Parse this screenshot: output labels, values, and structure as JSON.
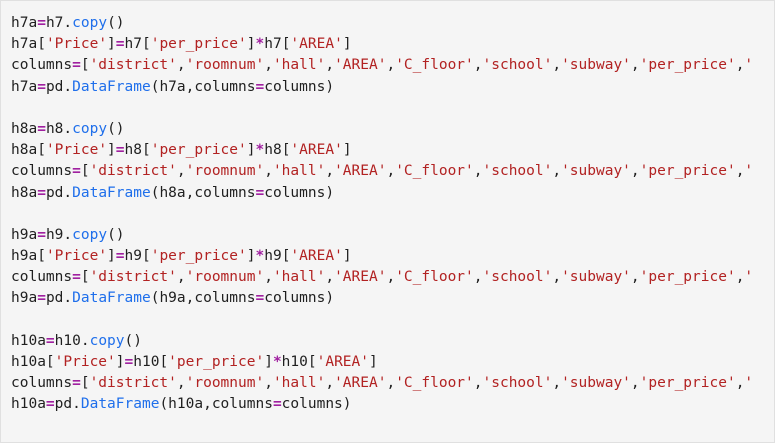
{
  "colors": {
    "panel_background": "#f5f5f5",
    "identifier": "#1f1f1f",
    "operator": "#a020a0",
    "string": "#b22222",
    "attribute": "#1f6feb"
  },
  "code": {
    "blocks": [
      {
        "lines": [
          {
            "tokens": [
              {
                "t": "ident",
                "v": "h7a"
              },
              {
                "t": "op",
                "v": "="
              },
              {
                "t": "ident",
                "v": "h7"
              },
              {
                "t": "punc",
                "v": "."
              },
              {
                "t": "attr",
                "v": "copy"
              },
              {
                "t": "punc",
                "v": "()"
              }
            ]
          },
          {
            "tokens": [
              {
                "t": "ident",
                "v": "h7a"
              },
              {
                "t": "punc",
                "v": "["
              },
              {
                "t": "str",
                "v": "'Price'"
              },
              {
                "t": "punc",
                "v": "]"
              },
              {
                "t": "op",
                "v": "="
              },
              {
                "t": "ident",
                "v": "h7"
              },
              {
                "t": "punc",
                "v": "["
              },
              {
                "t": "str",
                "v": "'per_price'"
              },
              {
                "t": "punc",
                "v": "]"
              },
              {
                "t": "op",
                "v": "*"
              },
              {
                "t": "ident",
                "v": "h7"
              },
              {
                "t": "punc",
                "v": "["
              },
              {
                "t": "str",
                "v": "'AREA'"
              },
              {
                "t": "punc",
                "v": "]"
              }
            ]
          },
          {
            "tokens": [
              {
                "t": "ident",
                "v": "columns"
              },
              {
                "t": "op",
                "v": "="
              },
              {
                "t": "punc",
                "v": "["
              },
              {
                "t": "str",
                "v": "'district'"
              },
              {
                "t": "punc",
                "v": ","
              },
              {
                "t": "str",
                "v": "'roomnum'"
              },
              {
                "t": "punc",
                "v": ","
              },
              {
                "t": "str",
                "v": "'hall'"
              },
              {
                "t": "punc",
                "v": ","
              },
              {
                "t": "str",
                "v": "'AREA'"
              },
              {
                "t": "punc",
                "v": ","
              },
              {
                "t": "str",
                "v": "'C_floor'"
              },
              {
                "t": "punc",
                "v": ","
              },
              {
                "t": "str",
                "v": "'school'"
              },
              {
                "t": "punc",
                "v": ","
              },
              {
                "t": "str",
                "v": "'subway'"
              },
              {
                "t": "punc",
                "v": ","
              },
              {
                "t": "str",
                "v": "'per_price'"
              },
              {
                "t": "punc",
                "v": ","
              },
              {
                "t": "str",
                "v": "'"
              }
            ]
          },
          {
            "tokens": [
              {
                "t": "ident",
                "v": "h7a"
              },
              {
                "t": "op",
                "v": "="
              },
              {
                "t": "ident",
                "v": "pd"
              },
              {
                "t": "punc",
                "v": "."
              },
              {
                "t": "attr",
                "v": "DataFrame"
              },
              {
                "t": "punc",
                "v": "("
              },
              {
                "t": "ident",
                "v": "h7a"
              },
              {
                "t": "punc",
                "v": ","
              },
              {
                "t": "ident",
                "v": "columns"
              },
              {
                "t": "op",
                "v": "="
              },
              {
                "t": "ident",
                "v": "columns"
              },
              {
                "t": "punc",
                "v": ")"
              }
            ]
          }
        ]
      },
      {
        "lines": [
          {
            "tokens": [
              {
                "t": "ident",
                "v": "h8a"
              },
              {
                "t": "op",
                "v": "="
              },
              {
                "t": "ident",
                "v": "h8"
              },
              {
                "t": "punc",
                "v": "."
              },
              {
                "t": "attr",
                "v": "copy"
              },
              {
                "t": "punc",
                "v": "()"
              }
            ]
          },
          {
            "tokens": [
              {
                "t": "ident",
                "v": "h8a"
              },
              {
                "t": "punc",
                "v": "["
              },
              {
                "t": "str",
                "v": "'Price'"
              },
              {
                "t": "punc",
                "v": "]"
              },
              {
                "t": "op",
                "v": "="
              },
              {
                "t": "ident",
                "v": "h8"
              },
              {
                "t": "punc",
                "v": "["
              },
              {
                "t": "str",
                "v": "'per_price'"
              },
              {
                "t": "punc",
                "v": "]"
              },
              {
                "t": "op",
                "v": "*"
              },
              {
                "t": "ident",
                "v": "h8"
              },
              {
                "t": "punc",
                "v": "["
              },
              {
                "t": "str",
                "v": "'AREA'"
              },
              {
                "t": "punc",
                "v": "]"
              }
            ]
          },
          {
            "tokens": [
              {
                "t": "ident",
                "v": "columns"
              },
              {
                "t": "op",
                "v": "="
              },
              {
                "t": "punc",
                "v": "["
              },
              {
                "t": "str",
                "v": "'district'"
              },
              {
                "t": "punc",
                "v": ","
              },
              {
                "t": "str",
                "v": "'roomnum'"
              },
              {
                "t": "punc",
                "v": ","
              },
              {
                "t": "str",
                "v": "'hall'"
              },
              {
                "t": "punc",
                "v": ","
              },
              {
                "t": "str",
                "v": "'AREA'"
              },
              {
                "t": "punc",
                "v": ","
              },
              {
                "t": "str",
                "v": "'C_floor'"
              },
              {
                "t": "punc",
                "v": ","
              },
              {
                "t": "str",
                "v": "'school'"
              },
              {
                "t": "punc",
                "v": ","
              },
              {
                "t": "str",
                "v": "'subway'"
              },
              {
                "t": "punc",
                "v": ","
              },
              {
                "t": "str",
                "v": "'per_price'"
              },
              {
                "t": "punc",
                "v": ","
              },
              {
                "t": "str",
                "v": "'"
              }
            ]
          },
          {
            "tokens": [
              {
                "t": "ident",
                "v": "h8a"
              },
              {
                "t": "op",
                "v": "="
              },
              {
                "t": "ident",
                "v": "pd"
              },
              {
                "t": "punc",
                "v": "."
              },
              {
                "t": "attr",
                "v": "DataFrame"
              },
              {
                "t": "punc",
                "v": "("
              },
              {
                "t": "ident",
                "v": "h8a"
              },
              {
                "t": "punc",
                "v": ","
              },
              {
                "t": "ident",
                "v": "columns"
              },
              {
                "t": "op",
                "v": "="
              },
              {
                "t": "ident",
                "v": "columns"
              },
              {
                "t": "punc",
                "v": ")"
              }
            ]
          }
        ]
      },
      {
        "lines": [
          {
            "tokens": [
              {
                "t": "ident",
                "v": "h9a"
              },
              {
                "t": "op",
                "v": "="
              },
              {
                "t": "ident",
                "v": "h9"
              },
              {
                "t": "punc",
                "v": "."
              },
              {
                "t": "attr",
                "v": "copy"
              },
              {
                "t": "punc",
                "v": "()"
              }
            ]
          },
          {
            "tokens": [
              {
                "t": "ident",
                "v": "h9a"
              },
              {
                "t": "punc",
                "v": "["
              },
              {
                "t": "str",
                "v": "'Price'"
              },
              {
                "t": "punc",
                "v": "]"
              },
              {
                "t": "op",
                "v": "="
              },
              {
                "t": "ident",
                "v": "h9"
              },
              {
                "t": "punc",
                "v": "["
              },
              {
                "t": "str",
                "v": "'per_price'"
              },
              {
                "t": "punc",
                "v": "]"
              },
              {
                "t": "op",
                "v": "*"
              },
              {
                "t": "ident",
                "v": "h9"
              },
              {
                "t": "punc",
                "v": "["
              },
              {
                "t": "str",
                "v": "'AREA'"
              },
              {
                "t": "punc",
                "v": "]"
              }
            ]
          },
          {
            "tokens": [
              {
                "t": "ident",
                "v": "columns"
              },
              {
                "t": "op",
                "v": "="
              },
              {
                "t": "punc",
                "v": "["
              },
              {
                "t": "str",
                "v": "'district'"
              },
              {
                "t": "punc",
                "v": ","
              },
              {
                "t": "str",
                "v": "'roomnum'"
              },
              {
                "t": "punc",
                "v": ","
              },
              {
                "t": "str",
                "v": "'hall'"
              },
              {
                "t": "punc",
                "v": ","
              },
              {
                "t": "str",
                "v": "'AREA'"
              },
              {
                "t": "punc",
                "v": ","
              },
              {
                "t": "str",
                "v": "'C_floor'"
              },
              {
                "t": "punc",
                "v": ","
              },
              {
                "t": "str",
                "v": "'school'"
              },
              {
                "t": "punc",
                "v": ","
              },
              {
                "t": "str",
                "v": "'subway'"
              },
              {
                "t": "punc",
                "v": ","
              },
              {
                "t": "str",
                "v": "'per_price'"
              },
              {
                "t": "punc",
                "v": ","
              },
              {
                "t": "str",
                "v": "'"
              }
            ]
          },
          {
            "tokens": [
              {
                "t": "ident",
                "v": "h9a"
              },
              {
                "t": "op",
                "v": "="
              },
              {
                "t": "ident",
                "v": "pd"
              },
              {
                "t": "punc",
                "v": "."
              },
              {
                "t": "attr",
                "v": "DataFrame"
              },
              {
                "t": "punc",
                "v": "("
              },
              {
                "t": "ident",
                "v": "h9a"
              },
              {
                "t": "punc",
                "v": ","
              },
              {
                "t": "ident",
                "v": "columns"
              },
              {
                "t": "op",
                "v": "="
              },
              {
                "t": "ident",
                "v": "columns"
              },
              {
                "t": "punc",
                "v": ")"
              }
            ]
          }
        ]
      },
      {
        "lines": [
          {
            "tokens": [
              {
                "t": "ident",
                "v": "h10a"
              },
              {
                "t": "op",
                "v": "="
              },
              {
                "t": "ident",
                "v": "h10"
              },
              {
                "t": "punc",
                "v": "."
              },
              {
                "t": "attr",
                "v": "copy"
              },
              {
                "t": "punc",
                "v": "()"
              }
            ]
          },
          {
            "tokens": [
              {
                "t": "ident",
                "v": "h10a"
              },
              {
                "t": "punc",
                "v": "["
              },
              {
                "t": "str",
                "v": "'Price'"
              },
              {
                "t": "punc",
                "v": "]"
              },
              {
                "t": "op",
                "v": "="
              },
              {
                "t": "ident",
                "v": "h10"
              },
              {
                "t": "punc",
                "v": "["
              },
              {
                "t": "str",
                "v": "'per_price'"
              },
              {
                "t": "punc",
                "v": "]"
              },
              {
                "t": "op",
                "v": "*"
              },
              {
                "t": "ident",
                "v": "h10"
              },
              {
                "t": "punc",
                "v": "["
              },
              {
                "t": "str",
                "v": "'AREA'"
              },
              {
                "t": "punc",
                "v": "]"
              }
            ]
          },
          {
            "tokens": [
              {
                "t": "ident",
                "v": "columns"
              },
              {
                "t": "op",
                "v": "="
              },
              {
                "t": "punc",
                "v": "["
              },
              {
                "t": "str",
                "v": "'district'"
              },
              {
                "t": "punc",
                "v": ","
              },
              {
                "t": "str",
                "v": "'roomnum'"
              },
              {
                "t": "punc",
                "v": ","
              },
              {
                "t": "str",
                "v": "'hall'"
              },
              {
                "t": "punc",
                "v": ","
              },
              {
                "t": "str",
                "v": "'AREA'"
              },
              {
                "t": "punc",
                "v": ","
              },
              {
                "t": "str",
                "v": "'C_floor'"
              },
              {
                "t": "punc",
                "v": ","
              },
              {
                "t": "str",
                "v": "'school'"
              },
              {
                "t": "punc",
                "v": ","
              },
              {
                "t": "str",
                "v": "'subway'"
              },
              {
                "t": "punc",
                "v": ","
              },
              {
                "t": "str",
                "v": "'per_price'"
              },
              {
                "t": "punc",
                "v": ","
              },
              {
                "t": "str",
                "v": "'"
              }
            ]
          },
          {
            "tokens": [
              {
                "t": "ident",
                "v": "h10a"
              },
              {
                "t": "op",
                "v": "="
              },
              {
                "t": "ident",
                "v": "pd"
              },
              {
                "t": "punc",
                "v": "."
              },
              {
                "t": "attr",
                "v": "DataFrame"
              },
              {
                "t": "punc",
                "v": "("
              },
              {
                "t": "ident",
                "v": "h10a"
              },
              {
                "t": "punc",
                "v": ","
              },
              {
                "t": "ident",
                "v": "columns"
              },
              {
                "t": "op",
                "v": "="
              },
              {
                "t": "ident",
                "v": "columns"
              },
              {
                "t": "punc",
                "v": ")"
              }
            ]
          }
        ]
      }
    ]
  }
}
